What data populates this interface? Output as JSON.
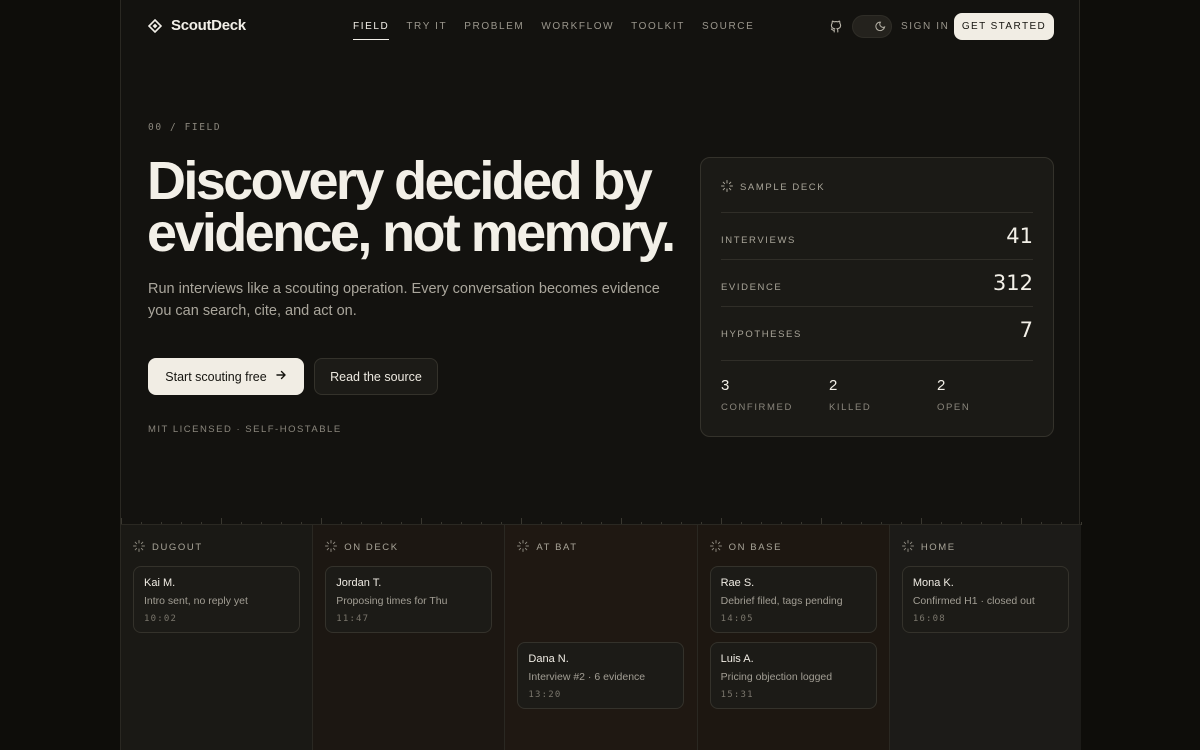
{
  "brand": {
    "name": "ScoutDeck"
  },
  "nav": {
    "links": [
      "FIELD",
      "TRY IT",
      "PROBLEM",
      "WORKFLOW",
      "TOOLKIT",
      "SOURCE"
    ],
    "active": "FIELD",
    "sign_in": "SIGN IN",
    "get_started": "GET STARTED"
  },
  "hero": {
    "eyebrow": "00 / FIELD",
    "headline_line1": "Discovery decided by",
    "headline_line2": "evidence, not memory.",
    "subhead": "Run interviews like a scouting operation. Every conversation becomes evidence you can search, cite, and act on.",
    "primary_cta": "Start scouting free",
    "secondary_cta": "Read the source",
    "footnote": "MIT LICENSED · SELF-HOSTABLE"
  },
  "deck": {
    "title": "SAMPLE DECK",
    "rows": [
      {
        "label": "INTERVIEWS",
        "value": "41"
      },
      {
        "label": "EVIDENCE",
        "value": "312"
      },
      {
        "label": "HYPOTHESES",
        "value": "7"
      }
    ],
    "stats": [
      {
        "value": "3",
        "label": "CONFIRMED"
      },
      {
        "value": "2",
        "label": "KILLED"
      },
      {
        "value": "2",
        "label": "OPEN"
      }
    ]
  },
  "board": {
    "columns": [
      {
        "title": "DUGOUT",
        "tint": "#1a1915",
        "cards": [
          {
            "name": "Kai M.",
            "desc": "Intro sent, no reply yet",
            "time": "10:02"
          }
        ]
      },
      {
        "title": "ON DECK",
        "tint": "#1c1712",
        "cards": [
          {
            "name": "Jordan T.",
            "desc": "Proposing times for Thu",
            "time": "11:47"
          }
        ]
      },
      {
        "title": "AT BAT",
        "tint": "#1f1812",
        "cards": [
          {
            "name": "Dana N.",
            "desc": "Interview #2 · 6 evidence",
            "time": "13:20"
          }
        ]
      },
      {
        "title": "ON BASE",
        "tint": "#1d1711",
        "cards": [
          {
            "name": "Rae S.",
            "desc": "Debrief filed, tags pending",
            "time": "14:05"
          },
          {
            "name": "Luis A.",
            "desc": "Pricing objection logged",
            "time": "15:31"
          }
        ]
      },
      {
        "title": "HOME",
        "tint": "#1c1b18",
        "cards": [
          {
            "name": "Mona K.",
            "desc": "Confirmed H1 · closed out",
            "time": "16:08"
          }
        ]
      }
    ]
  },
  "colors": {
    "accent": "#f1ede4",
    "background": "#13120f",
    "surface": "#1b1a16"
  },
  "icons": {
    "brand": "diamond-logo-icon",
    "deck": "sparkle-diamond-icon",
    "github": "github-icon",
    "theme": "moon-icon",
    "arrow": "arrow-right-icon"
  }
}
